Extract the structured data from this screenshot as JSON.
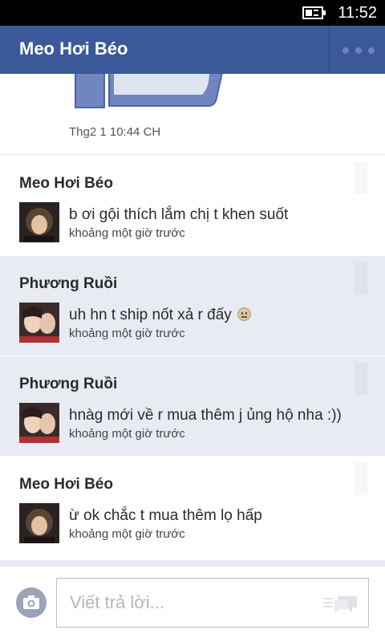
{
  "status_bar": {
    "time": "11:52",
    "battery_icon": "battery-charging-icon"
  },
  "header": {
    "title": "Meo Hơi Béo",
    "more_icon": "more-dots-icon"
  },
  "first_item": {
    "timestamp": "Thg2 1 10:44 CH",
    "image": "thumbs-up-sticker"
  },
  "messages": [
    {
      "sender": "Meo Hơi Béo",
      "text": "b ơi gội thích lắm chị t khen suốt",
      "time": "khoảng một giờ trước",
      "style": "white"
    },
    {
      "sender": "Phương Ruồi",
      "text": "uh hn t ship nốt xả r đấy",
      "time": "khoảng một giờ trước",
      "style": "shaded",
      "emoji": "smiley-icon"
    },
    {
      "sender": "Phương Ruồi",
      "text": "hnàg mới về r mua thêm j ủng hộ nha :))",
      "time": "khoảng một giờ trước",
      "style": "shaded"
    },
    {
      "sender": "Meo Hơi Béo",
      "text": "ừ ok chắc t mua thêm lọ hấp",
      "time": "khoảng một giờ trước",
      "style": "white"
    }
  ],
  "composer": {
    "placeholder": "Viết trả lời...",
    "camera_icon": "camera-icon",
    "sticker_icon": "chat-sticker-icon"
  },
  "colors": {
    "header_bg": "#3b5998",
    "shaded_row": "#e9ebf3",
    "status_bg": "#000000"
  }
}
